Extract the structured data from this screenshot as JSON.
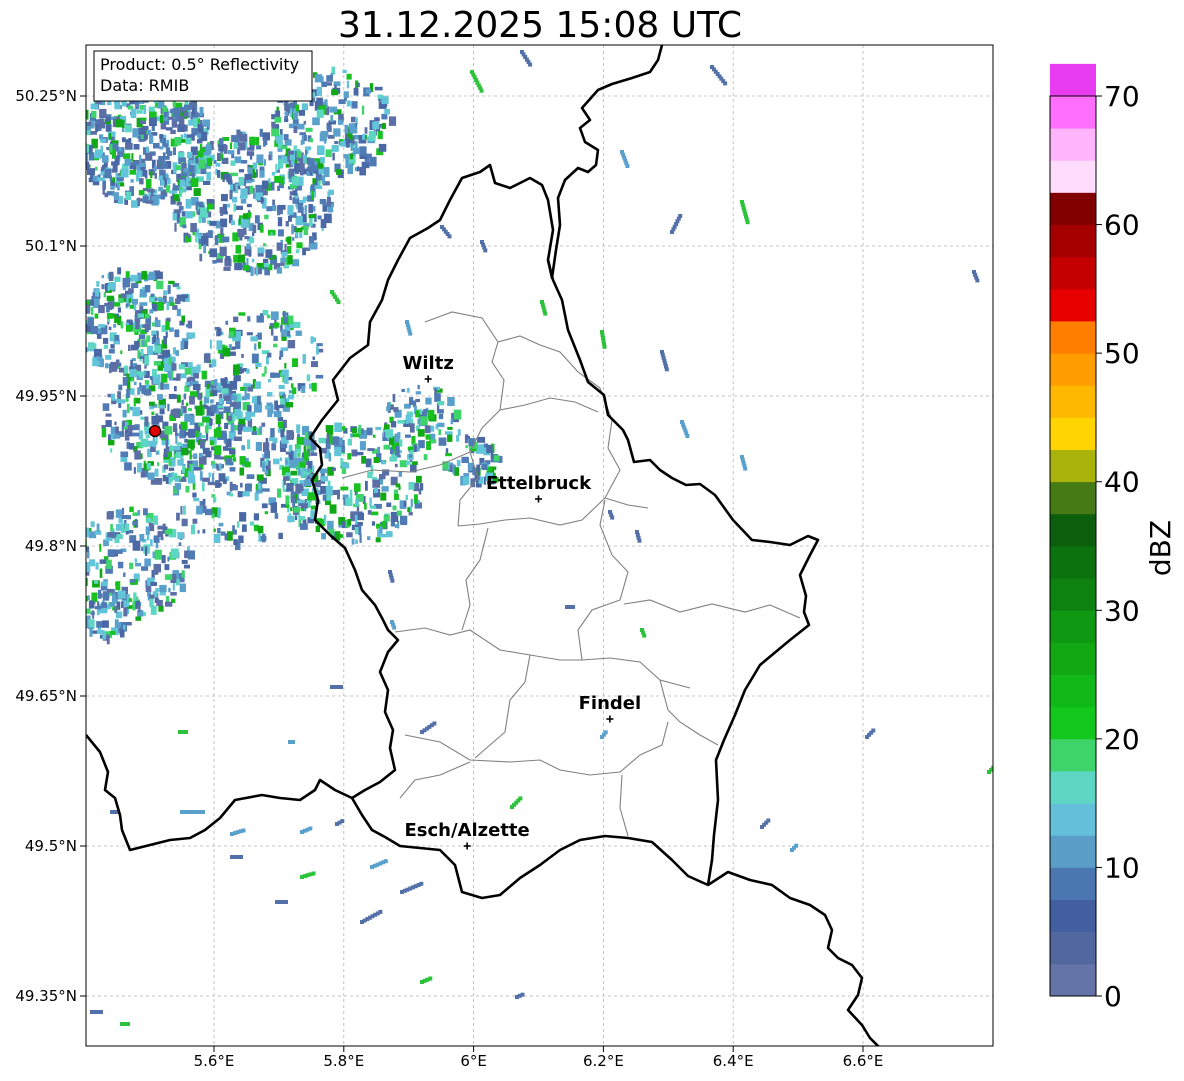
{
  "title": "31.12.2025 15:08 UTC",
  "info_box": {
    "product": "Product: 0.5° Reflectivity",
    "data": "Data: RMIB"
  },
  "axes": {
    "lon_ticks": [
      "5.6°E",
      "5.8°E",
      "6°E",
      "6.2°E",
      "6.4°E",
      "6.6°E"
    ],
    "lat_ticks": [
      "50.25°N",
      "50.1°N",
      "49.95°N",
      "49.8°N",
      "49.65°N",
      "49.5°N",
      "49.35°N"
    ]
  },
  "cities": [
    {
      "name": "Wiltz",
      "lon": 5.93,
      "lat": 49.967
    },
    {
      "name": "Ettelbruck",
      "lon": 6.1,
      "lat": 49.847
    },
    {
      "name": "Findel",
      "lon": 6.21,
      "lat": 49.627
    },
    {
      "name": "Esch/Alzette",
      "lon": 5.99,
      "lat": 49.5
    }
  ],
  "radar_site": {
    "lon": 5.505,
    "lat": 49.915
  },
  "colorbar": {
    "label": "dBZ",
    "ticks": [
      "0",
      "10",
      "20",
      "30",
      "40",
      "50",
      "60",
      "70"
    ],
    "colors": [
      "#6474a8",
      "#52679e",
      "#4260a0",
      "#4b77b0",
      "#5a9ec8",
      "#64c0da",
      "#5ed6c4",
      "#3ed46a",
      "#12c81c",
      "#10b818",
      "#12a814",
      "#0f9812",
      "#0d8210",
      "#0b720e",
      "#0a5e0c",
      "#467a14",
      "#aab20c",
      "#ffd400",
      "#ffb800",
      "#ff9c00",
      "#ff7e00",
      "#e60000",
      "#c40000",
      "#a40000",
      "#800000",
      "#ffdcfc",
      "#ffb4fc",
      "#ff6efc",
      "#e83cf0"
    ]
  }
}
